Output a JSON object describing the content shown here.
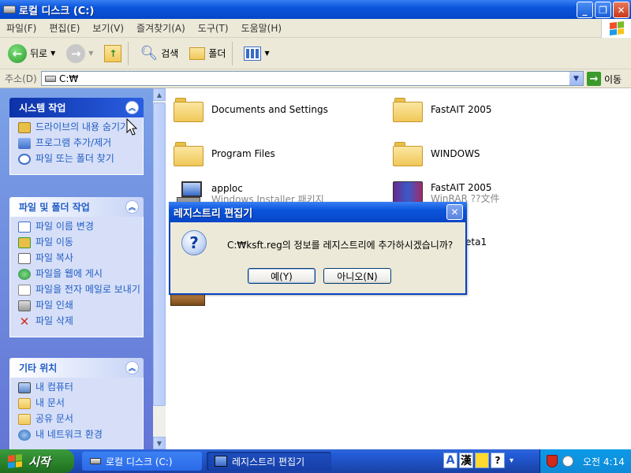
{
  "window": {
    "title": "로컬 디스크 (C:)",
    "minimize": "_",
    "restore": "❐",
    "close": "✕"
  },
  "menu": [
    "파일(F)",
    "편집(E)",
    "보기(V)",
    "즐겨찾기(A)",
    "도구(T)",
    "도움말(H)"
  ],
  "toolbar": {
    "back": "뒤로",
    "search": "검색",
    "folders": "폴더"
  },
  "address": {
    "label": "주소(D)",
    "value": "C:₩",
    "go": "이동"
  },
  "taskpane": {
    "groups": [
      {
        "title": "시스템 작업",
        "items": [
          "드라이브의 내용 숨기기",
          "프로그램 추가/제거",
          "파일 또는 폴더 찾기"
        ]
      },
      {
        "title": "파일 및 폴더 작업",
        "items": [
          "파일 이름 변경",
          "파일 이동",
          "파일 복사",
          "파일을 웹에 게시",
          "파일을 전자 메일로 보내기",
          "파일 인쇄",
          "파일 삭제"
        ]
      },
      {
        "title": "기타 위치",
        "items": [
          "내 컴퓨터",
          "내 문서",
          "공유 문서",
          "내 네트워크 환경"
        ]
      }
    ]
  },
  "files": [
    {
      "name": "Documents and Settings",
      "sub": ""
    },
    {
      "name": "FastAIT 2005",
      "sub": ""
    },
    {
      "name": "Program Files",
      "sub": ""
    },
    {
      "name": "WINDOWS",
      "sub": ""
    },
    {
      "name": "apploc",
      "sub": "Windows Installer 패키지"
    },
    {
      "name": "FastAIT 2005",
      "sub": "WinRAR ??文件"
    },
    {
      "name": "eta1",
      "sub": ""
    }
  ],
  "dialog": {
    "title": "레지스트리 편집기",
    "message": "C:₩ksft.reg의 정보를 레지스트리에 추가하시겠습니까?",
    "yes": "예(Y)",
    "no": "아니오(N)"
  },
  "taskbar": {
    "start": "시작",
    "tasks": [
      "로컬 디스크 (C:)",
      "레지스트리 편집기"
    ],
    "lang_a": "A",
    "lang_han": "漢",
    "lang_help": "?",
    "clock": "오전 4:14"
  },
  "colors": {
    "titlebar": "#0a55dc",
    "taskpane_bg": "#6f8fe0",
    "start_green": "#2f8a2f"
  }
}
